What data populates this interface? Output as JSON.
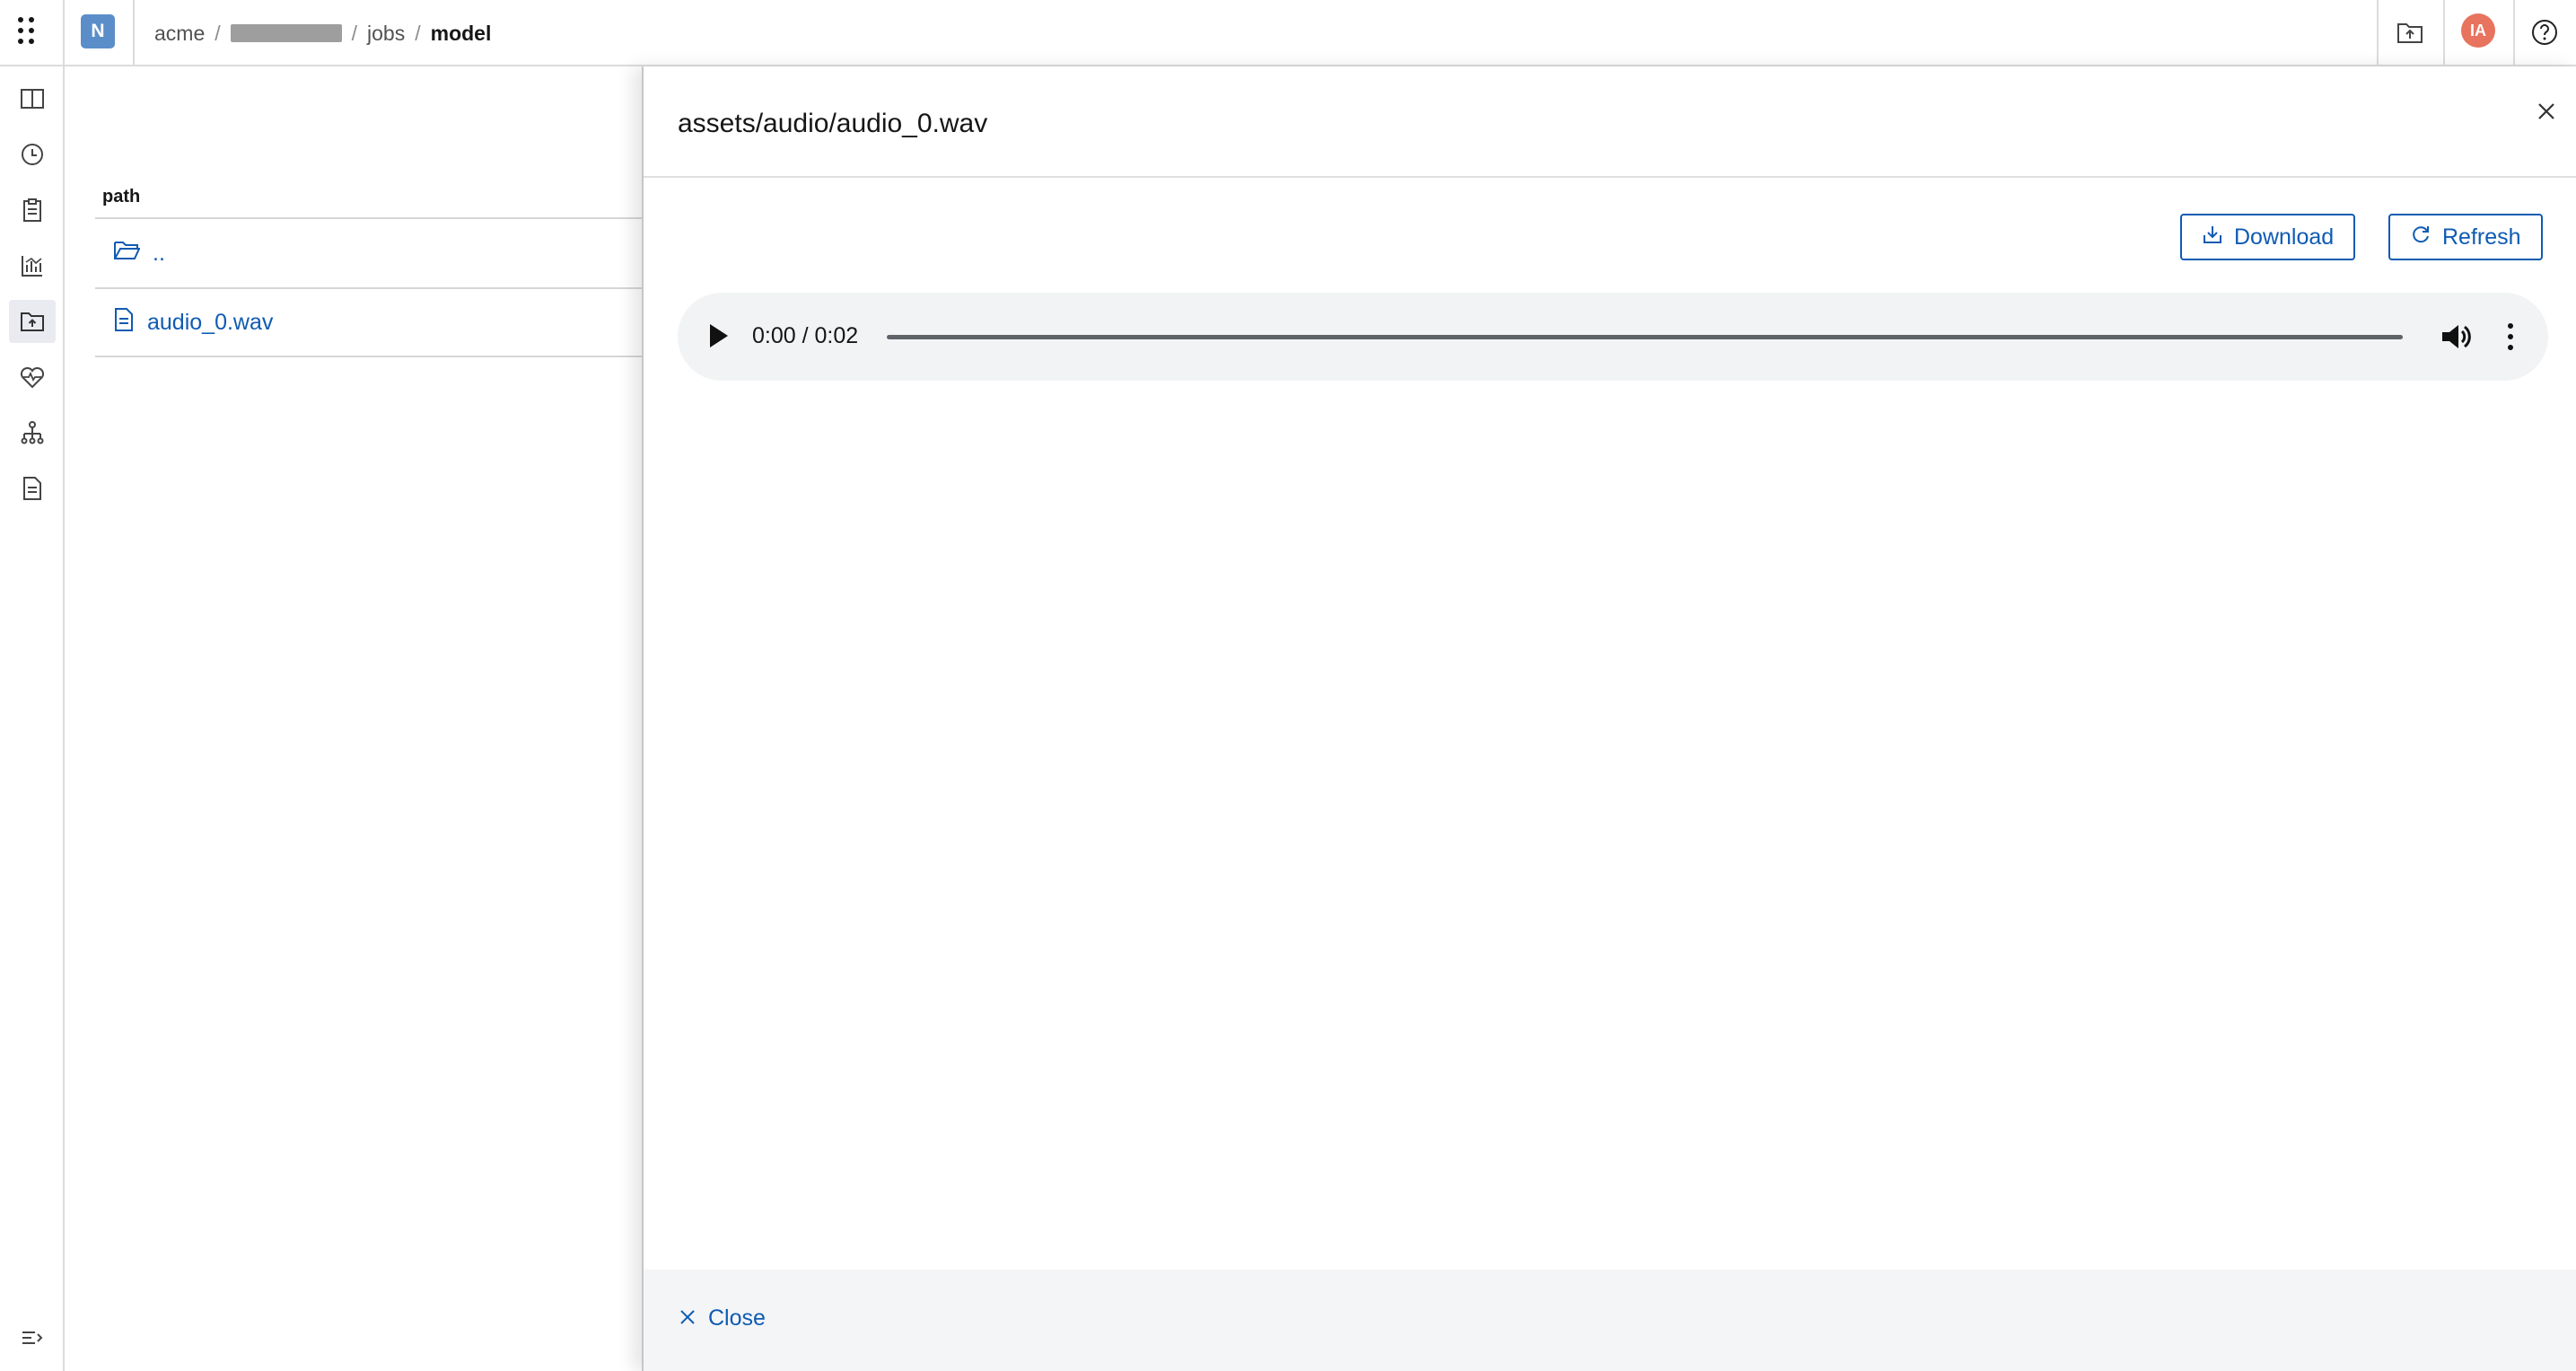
{
  "topbar": {
    "project_initial": "N",
    "breadcrumb": [
      "acme",
      "jobs",
      "model"
    ],
    "user_initials": "IA",
    "avatar_color": "#e8735e",
    "project_badge_color": "#5b8ec9"
  },
  "files": {
    "column_header": "path",
    "rows": [
      {
        "icon": "folder-icon",
        "label": ".."
      },
      {
        "icon": "file-icon",
        "label": "audio_0.wav"
      }
    ]
  },
  "panel": {
    "title": "assets/audio/audio_0.wav",
    "download_label": "Download",
    "refresh_label": "Refresh",
    "audio_time": "0:00 / 0:02",
    "close_label": "Close"
  },
  "colors": {
    "accent": "#0f5bb3",
    "border": "#dcdcdc",
    "footer_bg": "#f4f5f7",
    "player_bg": "#f1f3f4"
  },
  "icons": {
    "leftrail": [
      "columns-icon",
      "history-icon",
      "clipboard-icon",
      "chart-icon",
      "folder-upload-icon",
      "heart-monitor-icon",
      "hierarchy-icon",
      "document-icon",
      "expand-menu-icon"
    ],
    "topbar": [
      "grid-menu-icon",
      "folder-upload-icon",
      "help-icon"
    ]
  }
}
